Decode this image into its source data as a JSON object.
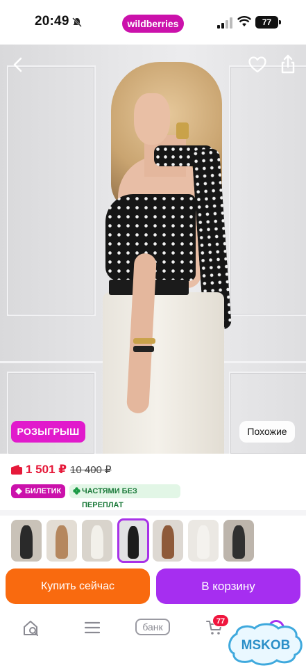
{
  "status_bar": {
    "time": "20:49",
    "app_pill": "wildberries",
    "battery": "77",
    "icons": [
      "bell-off-icon",
      "signal-icon",
      "wifi-icon",
      "battery-icon"
    ]
  },
  "product": {
    "promo_badge": "РОЗЫГРЫШ",
    "similar_button": "Похожие",
    "price": "1 501 ₽",
    "old_price": "10 400 ₽",
    "tags": {
      "ticket": "БИЛЕТИК",
      "installment": "ЧАСТЯМИ БЕЗ ПЕРЕПЛАТ"
    },
    "colors": {
      "brand": "#cb11ab",
      "price": "#e6193a",
      "buy_now": "#f96a0f",
      "add_to_cart": "#a62ef0",
      "installment_text": "#1b7a3a"
    }
  },
  "thumbnails": {
    "count_visible": 7,
    "selected_index": 3
  },
  "actions": {
    "buy_now": "Купить сейчас",
    "add_to_cart": "В корзину"
  },
  "bottom_nav": {
    "bank": "банк",
    "cart_count": "77",
    "icons": [
      "home-search-icon",
      "catalog-icon",
      "bank-icon",
      "cart-icon",
      "profile-icon"
    ]
  },
  "watermark": "MSKOB"
}
